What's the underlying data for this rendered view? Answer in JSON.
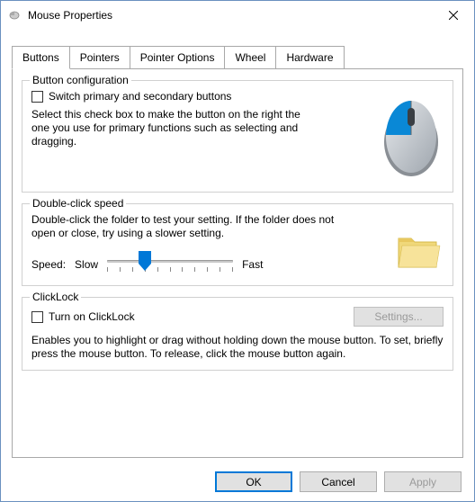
{
  "window": {
    "title": "Mouse Properties"
  },
  "tabs": [
    "Buttons",
    "Pointers",
    "Pointer Options",
    "Wheel",
    "Hardware"
  ],
  "activeTab": 0,
  "group1": {
    "legend": "Button configuration",
    "checkbox_label": "Switch primary and secondary buttons",
    "checkbox_checked": false,
    "desc": "Select this check box to make the button on the right the one you use for primary functions such as selecting and dragging."
  },
  "group2": {
    "legend": "Double-click speed",
    "desc": "Double-click the folder to test your setting. If the folder does not open or close, try using a slower setting.",
    "speed_label": "Speed:",
    "slow_label": "Slow",
    "fast_label": "Fast",
    "slider_value": 3,
    "slider_max": 10
  },
  "group3": {
    "legend": "ClickLock",
    "checkbox_label": "Turn on ClickLock",
    "checkbox_checked": false,
    "settings_label": "Settings...",
    "settings_enabled": false,
    "desc": "Enables you to highlight or drag without holding down the mouse button. To set, briefly press the mouse button. To release, click the mouse button again."
  },
  "buttons": {
    "ok": "OK",
    "cancel": "Cancel",
    "apply": "Apply"
  }
}
